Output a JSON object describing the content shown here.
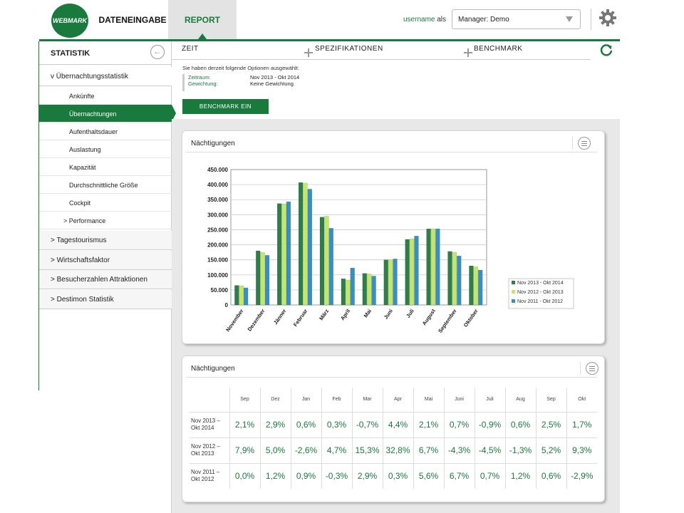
{
  "header": {
    "logo_text": "WEBMARK",
    "nav": [
      {
        "label": "DATENEINGABE"
      },
      {
        "label": "REPORT"
      }
    ],
    "username": "username",
    "username_suffix": "als",
    "manager_select": "Manager: Demo"
  },
  "sidebar": {
    "title": "STATISTIK",
    "section_open": "v Übernachtungsstatistik",
    "items": [
      {
        "label": "Ankünfte"
      },
      {
        "label": "Übernachtungen"
      },
      {
        "label": "Aufenthaltsdauer"
      },
      {
        "label": "Auslastung"
      },
      {
        "label": "Kapazität"
      },
      {
        "label": "Durchschnittliche Größe"
      },
      {
        "label": "Cockpit"
      },
      {
        "label": "> Performance"
      }
    ],
    "sections": [
      {
        "label": "> Tagestourismus"
      },
      {
        "label": "> Wirtschaftsfaktor"
      },
      {
        "label": "> Besucherzahlen Attraktionen"
      },
      {
        "label": "> Destimon Statistik"
      }
    ]
  },
  "filters": {
    "tabs": [
      {
        "label": "ZEIT"
      },
      {
        "label": "SPEZIFIKATIONEN"
      },
      {
        "label": "BENCHMARK"
      }
    ],
    "info": "Sie haben derzeit folgende Optionen ausgewählt:",
    "zeitraum_label": "Zeitraum:",
    "zeitraum_value": "Nov 2013 - Okt 2014",
    "gewichtung_label": "Gewichtung:",
    "gewichtung_value": "Keine Gewichtung",
    "benchmark_button": "BENCHMARK EIN"
  },
  "chart_panel": {
    "title": "Nächtigungen"
  },
  "chart_data": {
    "type": "bar",
    "categories": [
      "November",
      "Dezember",
      "Jänner",
      "Februar",
      "März",
      "April",
      "Mai",
      "Juni",
      "Juli",
      "August",
      "September",
      "Oktober"
    ],
    "series": [
      {
        "name": "Nov 2013 - Okt 2014",
        "color": "#2e7d4a",
        "values": [
          65000,
          180000,
          337000,
          407000,
          292000,
          87000,
          105000,
          150000,
          218000,
          253000,
          178000,
          130000
        ]
      },
      {
        "name": "Nov 2012 - Okt 2013",
        "color": "#c2e86b",
        "values": [
          64000,
          175000,
          336000,
          405000,
          295000,
          83000,
          103000,
          150000,
          220000,
          253000,
          175000,
          127000
        ]
      },
      {
        "name": "Nov 2011 - Okt 2012",
        "color": "#3a8fbf",
        "values": [
          57000,
          165000,
          343000,
          385000,
          255000,
          123000,
          96000,
          153000,
          229000,
          253000,
          163000,
          116000
        ]
      }
    ],
    "y_ticks": [
      "0",
      "50.000",
      "100.000",
      "150.000",
      "200.000",
      "250.000",
      "300.000",
      "350.000",
      "400.000",
      "450.000"
    ],
    "ylim": [
      0,
      450000
    ],
    "grid": true,
    "legend_position": "right"
  },
  "table_panel": {
    "title": "Nächtigungen",
    "columns": [
      "Sep",
      "Dez",
      "Jan",
      "Feb",
      "Mar",
      "Apr",
      "Mai",
      "Juni",
      "Juli",
      "Aug",
      "Sep",
      "Okt"
    ],
    "rows": [
      {
        "label1": "Nov 2013 –",
        "label2": "Okt 2014",
        "values": [
          "2,1%",
          "2,9%",
          "0,6%",
          "0,3%",
          "-0,7%",
          "4,4%",
          "2,1%",
          "0,7%",
          "-0,9%",
          "0,6%",
          "2,5%",
          "1,7%"
        ]
      },
      {
        "label1": "Nov 2012 –",
        "label2": "Okt 2013",
        "values": [
          "7,9%",
          "5,0%",
          "-2,6%",
          "4,7%",
          "15,3%",
          "32,8%",
          "6,7%",
          "-4,3%",
          "-4,5%",
          "-1,3%",
          "5,2%",
          "9,3%"
        ]
      },
      {
        "label1": "Nov 2011 –",
        "label2": "Okt 2012",
        "values": [
          "0,0%",
          "1,2%",
          "0,9%",
          "-0,3%",
          "2,9%",
          "0,3%",
          "5,6%",
          "6,7%",
          "0,7%",
          "1,2%",
          "0,6%",
          "-2,9%"
        ]
      }
    ]
  }
}
